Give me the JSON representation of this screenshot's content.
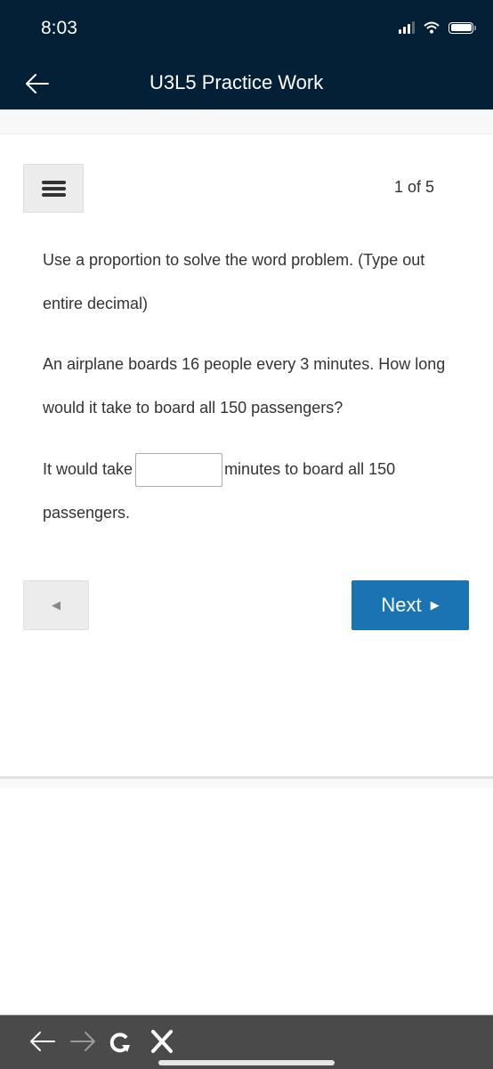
{
  "status_bar": {
    "time": "8:03",
    "icons": [
      "signal-icon",
      "wifi-icon",
      "battery-icon"
    ]
  },
  "header": {
    "back_icon": "arrow-left-icon",
    "title": "U3L5 Practice Work"
  },
  "question_nav": {
    "menu_icon": "hamburger-menu-icon",
    "counter": "1 of 5"
  },
  "question": {
    "instructions": "Use a proportion to solve the word problem. (Type out entire decimal)",
    "problem": "An airplane boards 16 people every 3 minutes.  How long would it take to board all 150 passengers?",
    "answer_prefix": "It would take",
    "answer_value": "",
    "answer_suffix": "minutes to board all 150 passengers."
  },
  "navigation": {
    "prev_icon": "triangle-left-icon",
    "next_label": "Next",
    "next_icon": "triangle-right-icon"
  },
  "browser_bar": {
    "icons": [
      "back-arrow-icon",
      "forward-arrow-icon",
      "reload-icon",
      "close-icon"
    ]
  },
  "colors": {
    "header_bg": "#032036",
    "next_button": "#1a73b3",
    "browser_bar_bg": "#4a4a4a"
  }
}
